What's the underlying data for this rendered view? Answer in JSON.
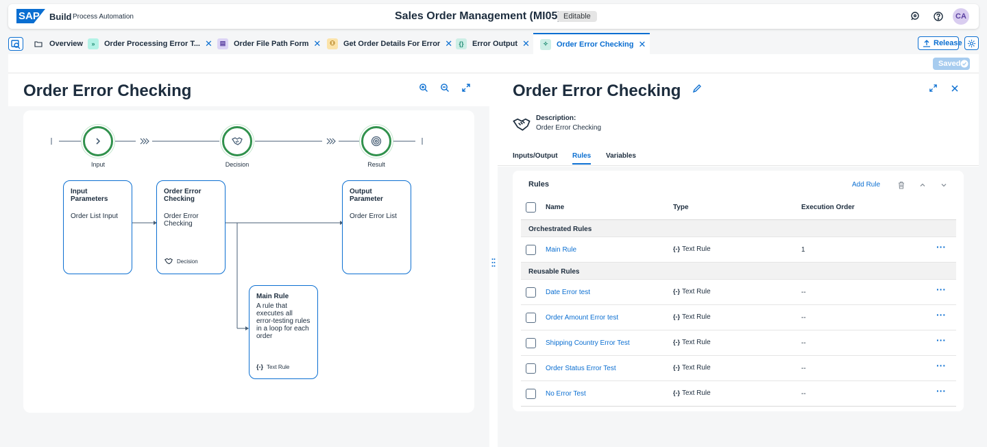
{
  "shell": {
    "logo": "SAP",
    "brand": "Build",
    "product": "Process Automation",
    "title": "Sales Order Management (MI05)",
    "status": "Editable",
    "avatar": "CA"
  },
  "tabs": [
    {
      "label": "Overview",
      "icon": "folder-icon"
    },
    {
      "label": "Order Processing Error T...",
      "icon": "process-icon",
      "color": "#b3f2e6"
    },
    {
      "label": "Order File Path Form",
      "icon": "form-icon",
      "color": "#dcd4f5"
    },
    {
      "label": "Get Order Details For Error",
      "icon": "action-icon",
      "color": "#fbe3a9"
    },
    {
      "label": "Error Output",
      "icon": "data-type-icon",
      "color": "#cdeee6"
    },
    {
      "label": "Order Error Checking",
      "icon": "decision-icon",
      "color": "#cdeee6",
      "active": true
    }
  ],
  "toolbar": {
    "release": "Release",
    "saved": "Saved"
  },
  "left": {
    "title": "Order Error Checking",
    "steps": [
      {
        "label": "Input"
      },
      {
        "label": "Decision"
      },
      {
        "label": "Result"
      }
    ],
    "cards": {
      "input": {
        "heading": "Input Parameters",
        "body": "Order List Input"
      },
      "decision": {
        "heading": "Order Error Checking",
        "body": "Order Error Checking",
        "footer": "Decision"
      },
      "output": {
        "heading": "Output Parameter",
        "body": "Order Error List"
      },
      "rule": {
        "heading": "Main Rule",
        "body": "A rule that executes all error-testing rules in a loop for each order",
        "footer": "Text Rule"
      }
    }
  },
  "right": {
    "title": "Order Error Checking",
    "description_label": "Description:",
    "description": "Order Error Checking",
    "tabs": [
      "Inputs/Output",
      "Rules",
      "Variables"
    ],
    "active_tab": "Rules",
    "rules": {
      "title": "Rules",
      "add_label": "Add Rule",
      "columns": [
        "Name",
        "Type",
        "Execution Order"
      ],
      "groups": [
        {
          "label": "Orchestrated Rules",
          "items": [
            {
              "name": "Main Rule",
              "type": "Text Rule",
              "order": "1"
            }
          ]
        },
        {
          "label": "Reusable Rules",
          "items": [
            {
              "name": "Date Error test",
              "type": "Text Rule",
              "order": "--"
            },
            {
              "name": "Order Amount Error test",
              "type": "Text Rule",
              "order": "--"
            },
            {
              "name": "Shipping Country Error Test",
              "type": "Text Rule",
              "order": "--"
            },
            {
              "name": "Order Status Error Test",
              "type": "Text Rule",
              "order": "--"
            },
            {
              "name": "No Error Test",
              "type": "Text Rule",
              "order": "--"
            }
          ]
        }
      ]
    }
  }
}
